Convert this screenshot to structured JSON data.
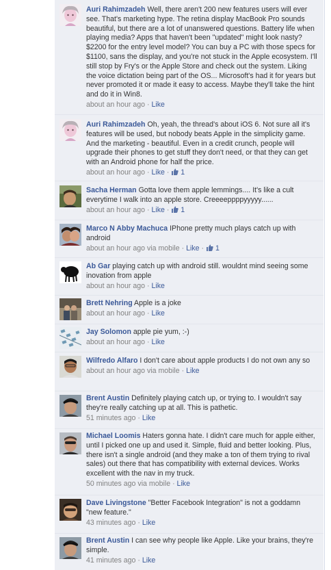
{
  "comments": [
    {
      "author": "Auri Rahimzadeh",
      "text": "Well, there aren't 200 new features users will ever see. That's marketing hype. The retina display MacBook Pro sounds beautiful, but there are a lot of unanswered questions. Battery life when playing media? Apps that haven't been \"updated\" might look nasty? $2200 for the entry level model? You can buy a PC with those specs for $1100, sans the display, and you're not stuck in the Apple ecosystem. I'll still stop by Fry's or the Apple Store and check out the system. Liking the voice dictation being part of the OS... Microsoft's had it for years but never promoted it or made it easy to access. Maybe they'll take the hint and do it in Win8.",
      "time": "about an hour ago",
      "via": "",
      "like_label": "Like",
      "likes": ""
    },
    {
      "author": "Auri Rahimzadeh",
      "text": "Oh, yeah, the thread's about iOS 6. Not sure all it's features will be used, but nobody beats Apple in the simplicity game. And the marketing - beautiful. Even in a credit crunch, people will upgrade their phones to get stuff they don't need, or that they can get with an Android phone for half the price.",
      "time": "about an hour ago",
      "via": "",
      "like_label": "Like",
      "likes": "1"
    },
    {
      "author": "Sacha Herman",
      "text": "Gotta love them apple lemmings.... It's like a cult everytime I walk into an apple store. Creeeeppppyyyyy......",
      "time": "about an hour ago",
      "via": "",
      "like_label": "Like",
      "likes": "1"
    },
    {
      "author": "Marco N Abby Machuca",
      "text": "IPhone pretty much plays catch up with android",
      "time": "about an hour ago",
      "via": "via mobile",
      "like_label": "Like",
      "likes": "1"
    },
    {
      "author": "Ab Gar",
      "text": "playing catch up with android still. wouldnt mind seeing some inovation from apple",
      "time": "about an hour ago",
      "via": "",
      "like_label": "Like",
      "likes": ""
    },
    {
      "author": "Brett Nehring",
      "text": "Apple is a joke",
      "time": "about an hour ago",
      "via": "",
      "like_label": "Like",
      "likes": ""
    },
    {
      "author": "Jay Solomon",
      "text": "apple pie yum, :-)",
      "time": "about an hour ago",
      "via": "",
      "like_label": "Like",
      "likes": ""
    },
    {
      "author": "Wilfredo Alfaro",
      "text": "I don't care about apple products I do not own any so",
      "time": "about an hour ago",
      "via": "via mobile",
      "like_label": "Like",
      "likes": ""
    },
    {
      "author": "Brent Austin",
      "text": "Definitely playing catch up, or trying to. I wouldn't say they're really catching up at all. This is pathetic.",
      "time": "51 minutes ago",
      "via": "",
      "like_label": "Like",
      "likes": ""
    },
    {
      "author": "Michael Loomis",
      "text": "Haters gonna hate. I didn't care much for apple either, until I picked one up and used it. Simple, fluid and better looking. Plus, there isn't a single android (and they make a ton of them trying to rival sales) out there that has compatibility with external devices. Works excellent with the nav in my truck.",
      "time": "50 minutes ago",
      "via": "via mobile",
      "like_label": "Like",
      "likes": ""
    },
    {
      "author": "Dave Livingstone",
      "text": "\"Better Facebook Integration\" is not a goddamn \"new feature.\"",
      "time": "43 minutes ago",
      "via": "",
      "like_label": "Like",
      "likes": ""
    },
    {
      "author": "Brent Austin",
      "text": "I can see why people like Apple. Like your brains, they're simple.",
      "time": "41 minutes ago",
      "via": "",
      "like_label": "Like",
      "likes": ""
    }
  ],
  "colors": {
    "feed_bg": "#edeff4",
    "link": "#3b5998",
    "meta": "#808080"
  }
}
